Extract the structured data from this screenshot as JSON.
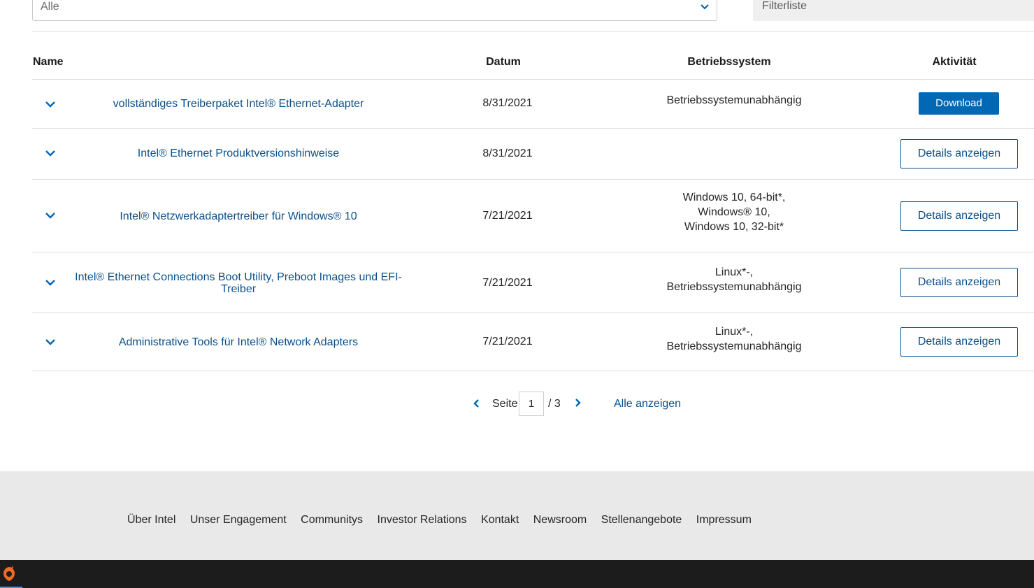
{
  "filters": {
    "select_value": "Alle",
    "filter_list_placeholder": "Filterliste"
  },
  "table": {
    "headers": {
      "name": "Name",
      "date": "Datum",
      "os": "Betriebssystem",
      "activity": "Aktivität"
    },
    "rows": [
      {
        "name": "vollständiges Treiberpaket Intel® Ethernet-Adapter",
        "date": "8/31/2021",
        "os": [
          "Betriebssystemunabhängig"
        ],
        "action": "Download"
      },
      {
        "name": "Intel® Ethernet Produktversionshinweise",
        "date": "8/31/2021",
        "os": [],
        "action": "Details anzeigen"
      },
      {
        "name": "Intel® Netzwerkadaptertreiber für Windows® 10",
        "date": "7/21/2021",
        "os": [
          "Windows 10, 64-bit*,",
          "Windows® 10,",
          "Windows 10, 32-bit*"
        ],
        "action": "Details anzeigen"
      },
      {
        "name": "Intel® Ethernet Connections Boot Utility, Preboot Images und EFI-Treiber",
        "name_line1": "Intel® Ethernet Connections Boot Utility, Preboot Images und EFI-",
        "name_line2": "Treiber",
        "date": "7/21/2021",
        "os": [
          "Linux*-,",
          "Betriebssystemunabhängig"
        ],
        "action": "Details anzeigen"
      },
      {
        "name": "Administrative Tools für Intel® Network Adapters",
        "date": "7/21/2021",
        "os": [
          "Linux*-,",
          "Betriebssystemunabhängig"
        ],
        "action": "Details anzeigen"
      }
    ]
  },
  "pagination": {
    "label": "Seite",
    "current_page": "1",
    "total": "/ 3",
    "show_all": "Alle anzeigen"
  },
  "footer": {
    "links": [
      "Über Intel",
      "Unser Engagement",
      "Communitys",
      "Investor Relations",
      "Kontakt",
      "Newsroom",
      "Stellenangebote",
      "Impressum"
    ]
  },
  "colors": {
    "link": "#0b4f8a",
    "primary_button": "#0068b5",
    "footer_bg": "#e9e9e9",
    "taskbar_bg": "#1c1c1c",
    "app_icon": "#f26b21"
  },
  "icons": {
    "row_toggle": "chevron-down-icon",
    "select_toggle": "chevron-down-icon",
    "prev": "chevron-left-icon",
    "next": "chevron-right-icon",
    "taskbar_app": "origin-app-icon"
  }
}
